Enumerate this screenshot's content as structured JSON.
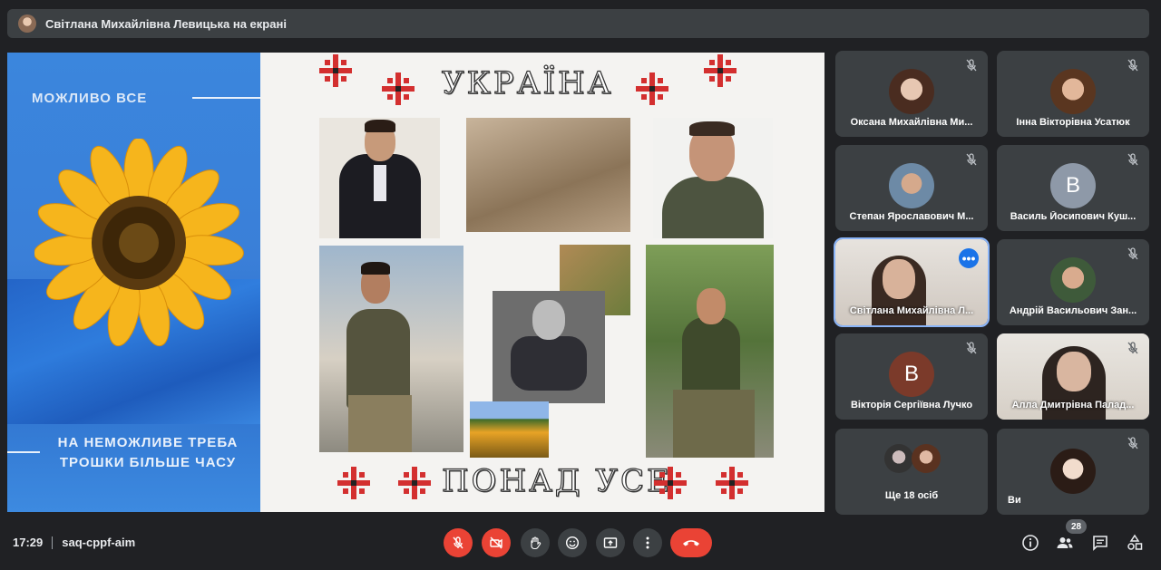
{
  "banner": {
    "presenter_label": "Світлана Михайлівна Левицька на екрані"
  },
  "slide": {
    "left_top_text": "МОЖЛИВО ВСЕ",
    "left_bottom_text": "НА НЕМОЖЛИВЕ ТРЕБА ТРОШКИ БІЛЬШЕ ЧАСУ",
    "title": "УКРАЇНА",
    "subtitle": "ПОНАД УСЕ"
  },
  "participants": [
    {
      "name": "Оксана Михайлівна Ми...",
      "type": "photo",
      "muted": true
    },
    {
      "name": "Інна Вікторівна Усатюк",
      "type": "photo",
      "muted": true
    },
    {
      "name": "Степан Ярославович М...",
      "type": "photo",
      "muted": true
    },
    {
      "name": "Василь Йосипович Куш...",
      "type": "letter",
      "letter": "В",
      "color": "#8e99a8",
      "muted": true
    },
    {
      "name": "Світлана Михайлівна Л...",
      "type": "video",
      "muted": false
    },
    {
      "name": "Андрій Васильович Зан...",
      "type": "photo",
      "muted": true
    },
    {
      "name": "Вікторія Сергіївна Лучко",
      "type": "letter",
      "letter": "В",
      "color": "#7b3a2a",
      "muted": true
    },
    {
      "name": "Алла Дмитрівна Палад...",
      "type": "video",
      "muted": true
    },
    {
      "name": "Ще 18 осіб",
      "type": "group",
      "muted": false
    },
    {
      "name": "Ви",
      "type": "photo",
      "muted": true
    }
  ],
  "bottom": {
    "time": "17:29",
    "meeting_code": "saq-cppf-aim",
    "participant_count": "28"
  },
  "colors": {
    "background": "#202124",
    "tile": "#3c4043",
    "red": "#ea4335",
    "active_outline": "#8ab4f8"
  }
}
